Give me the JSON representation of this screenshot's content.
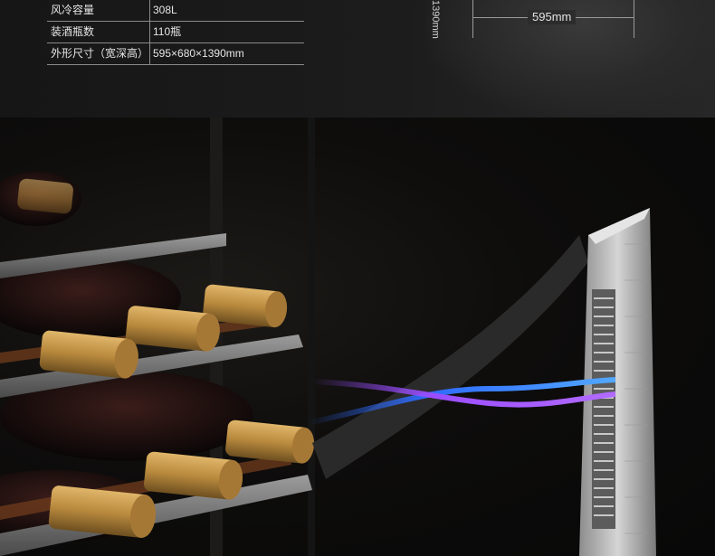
{
  "specs": [
    {
      "label": "风冷容量",
      "value": "308L"
    },
    {
      "label": "装酒瓶数",
      "value": "110瓶"
    },
    {
      "label": "外形尺寸（宽深高）",
      "value": "595×680×1390mm"
    }
  ],
  "dimension": {
    "width_label": "595mm",
    "height_label": "1390mm"
  },
  "colors": {
    "airflow_blue": "#2f6bff",
    "airflow_purple": "#9a4dff",
    "capsule_gold": "#b98a3e",
    "shelf_gray": "#6a6a6a"
  },
  "icons": {
    "fan_tower": "cooling-fan-illustration",
    "wine_bottles": "wine-bottle-illustration"
  }
}
